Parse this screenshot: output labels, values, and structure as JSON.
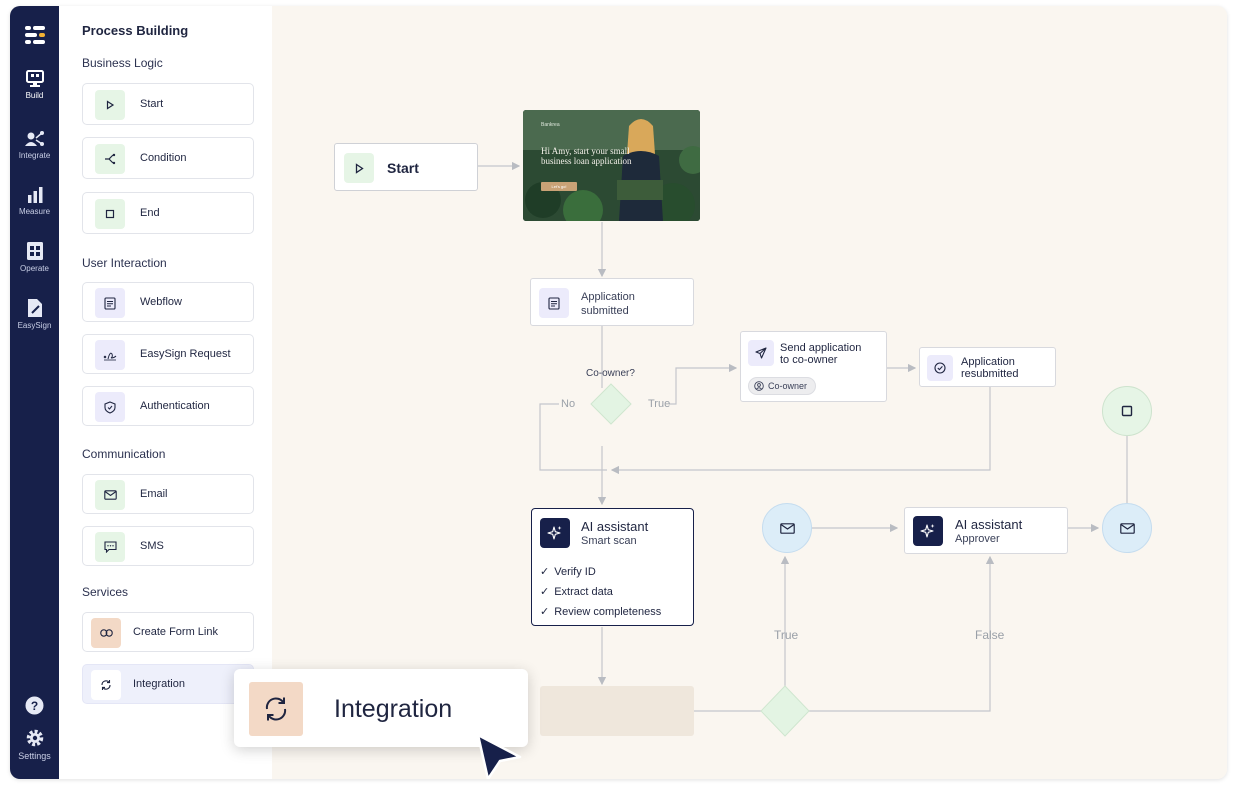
{
  "rail": {
    "items": [
      {
        "label": "Build",
        "icon": "build-icon"
      },
      {
        "label": "Integrate",
        "icon": "integrate-icon"
      },
      {
        "label": "Measure",
        "icon": "measure-icon"
      },
      {
        "label": "Operate",
        "icon": "operate-icon"
      },
      {
        "label": "EasySign",
        "icon": "easysign-icon"
      }
    ],
    "settings_label": "Settings"
  },
  "panel": {
    "title": "Process Building",
    "sections": {
      "business_logic": "Business Logic",
      "user_interaction": "User Interaction",
      "communication": "Communication",
      "services": "Services"
    },
    "items": {
      "start": "Start",
      "condition": "Condition",
      "end": "End",
      "webflow": "Webflow",
      "easysign": "EasySign Request",
      "authentication": "Authentication",
      "email": "Email",
      "sms": "SMS",
      "create_form_link": "Create Form Link",
      "integration": "Integration"
    }
  },
  "flow": {
    "start_label": "Start",
    "hero": {
      "brand": "Bankrea",
      "headline": "Hi Amy, start your small business loan application",
      "cta": "Let's go!"
    },
    "application_submitted": "Application submitted",
    "co_owner_question": "Co-owner?",
    "no_label": "No",
    "true_label": "True",
    "send_application_line1": "Send application",
    "send_application_line2": "to co-owner",
    "co_owner_tag": "Co-owner",
    "application_resubmitted_line1": "Application",
    "application_resubmitted_line2": "resubmitted",
    "ai_smart": {
      "title": "AI assistant",
      "subtitle": "Smart scan",
      "checks": [
        "Verify ID",
        "Extract data",
        "Review completeness"
      ]
    },
    "ai_approver": {
      "title": "AI assistant",
      "subtitle": "Approver"
    },
    "branch_true": "True",
    "branch_false": "False"
  },
  "drag_card": {
    "label": "Integration"
  },
  "colors": {
    "rail_bg": "#17204a",
    "canvas_bg": "#faf6f0",
    "green_tint": "#e6f5e6",
    "purple_tint": "#ecebfb",
    "blue_tint": "#dcedf8",
    "orange_tint": "#f3d9c6",
    "navy": "#17204a"
  }
}
